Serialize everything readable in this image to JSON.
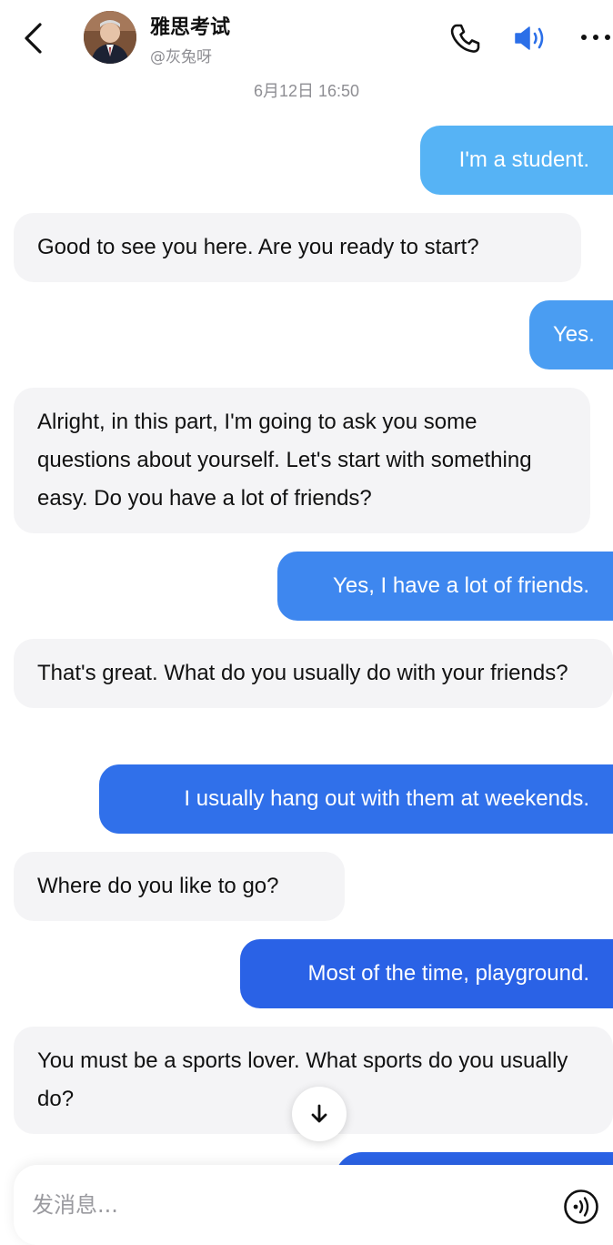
{
  "header": {
    "title": "雅思考试",
    "handle": "@灰兔呀"
  },
  "timestamp": "6月12日 16:50",
  "messages": [
    {
      "side": "out",
      "text": "I'm a student.",
      "color": "#56b3f5"
    },
    {
      "side": "in",
      "text": "Good to see you here. Are you ready to start?"
    },
    {
      "side": "out",
      "text": "Yes.",
      "color": "#4a9df2"
    },
    {
      "side": "in",
      "text": "Alright, in this part, I'm going to ask you some questions about yourself. Let's start with something easy. Do you have a lot of friends?"
    },
    {
      "side": "out",
      "text": "Yes, I have a lot of friends.",
      "color": "#3e87ef"
    },
    {
      "side": "in",
      "text": "That's great. What do you usually do with your friends?"
    },
    {
      "side": "out",
      "text": "I usually hang out with them at weekends.",
      "color": "#3070ea"
    },
    {
      "side": "in",
      "text": "Where do you like to go?"
    },
    {
      "side": "out",
      "text": "Most of the time, playground.",
      "color": "#2a62e6"
    },
    {
      "side": "in",
      "text": "You must be a sports lover. What sports do you usually do?"
    }
  ],
  "composer": {
    "placeholder": "发消息..."
  },
  "icons": {
    "back": "chevron-left-icon",
    "phone": "phone-icon",
    "speaker": "speaker-icon",
    "more": "more-icon",
    "scroll_down": "arrow-down-icon",
    "voice": "voice-input-icon"
  }
}
